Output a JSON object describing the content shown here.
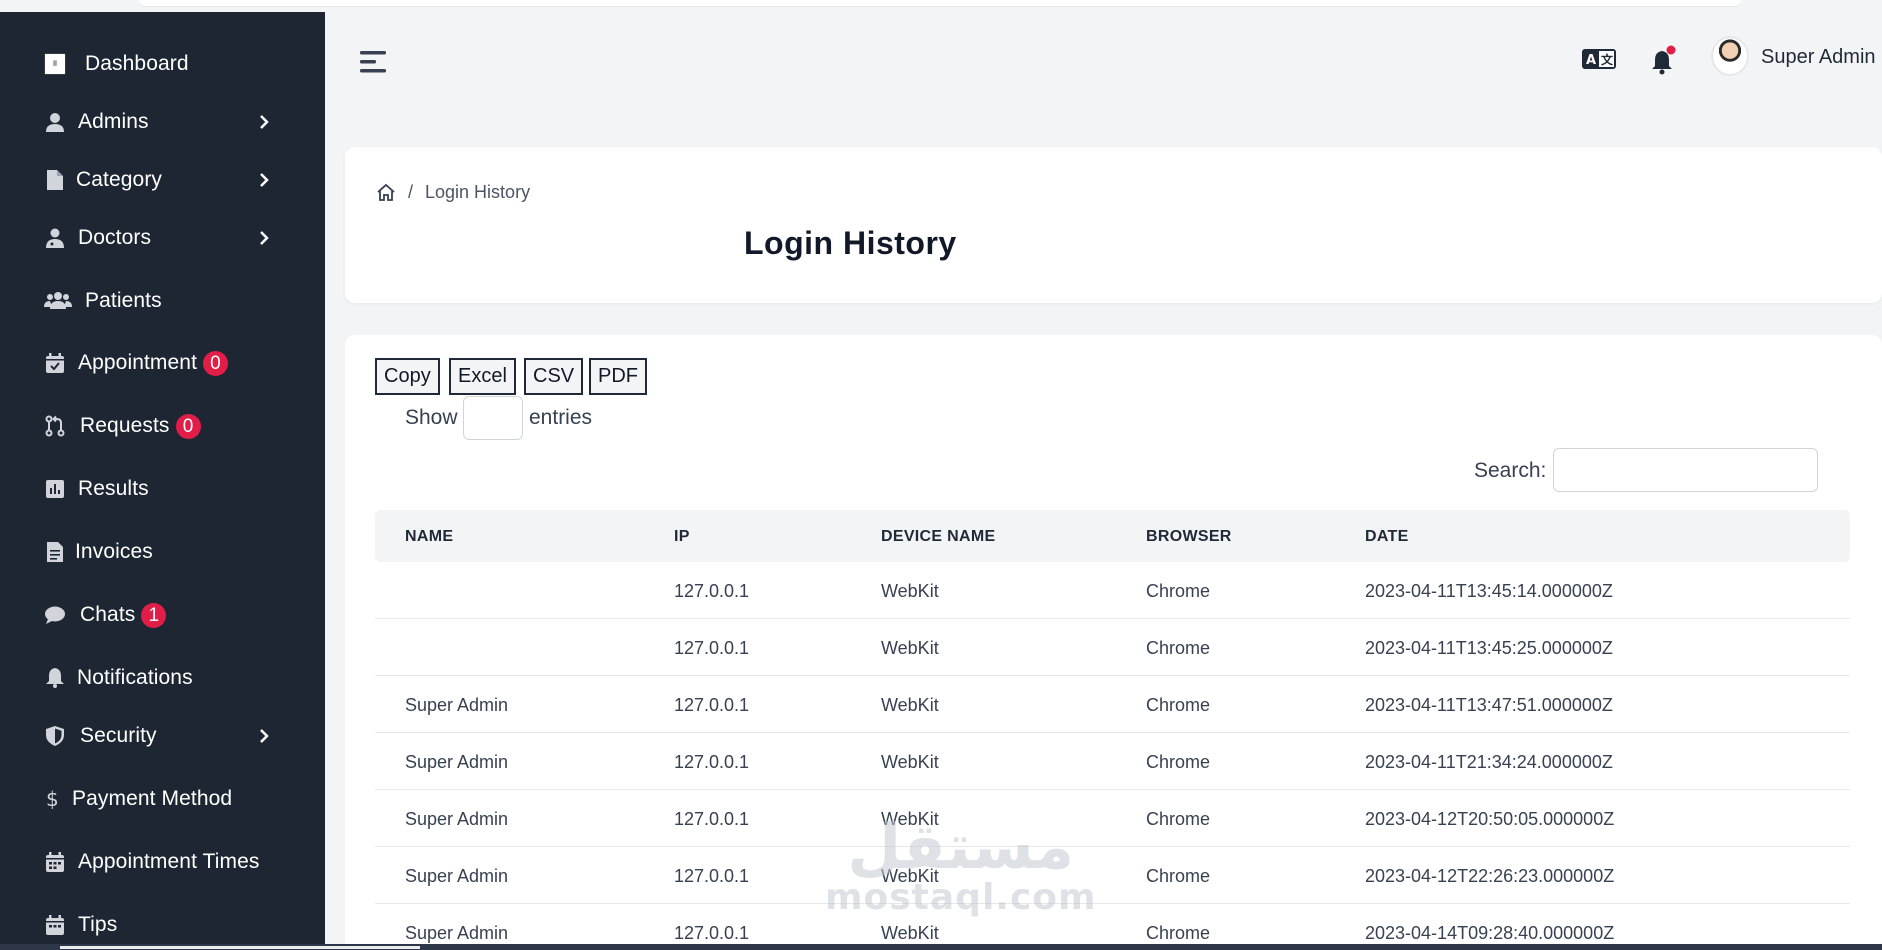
{
  "sidebar": {
    "items": [
      {
        "label": "Dashboard",
        "icon": "dashboard-icon",
        "badge": null,
        "has_submenu": false
      },
      {
        "label": "Admins",
        "icon": "user-icon",
        "badge": null,
        "has_submenu": true
      },
      {
        "label": "Category",
        "icon": "file-icon",
        "badge": null,
        "has_submenu": true
      },
      {
        "label": "Doctors",
        "icon": "doctor-icon",
        "badge": null,
        "has_submenu": true
      },
      {
        "label": "Patients",
        "icon": "users-icon",
        "badge": null,
        "has_submenu": false
      },
      {
        "label": "Appointment",
        "icon": "calendar-check-icon",
        "badge": "0",
        "has_submenu": false
      },
      {
        "label": "Requests",
        "icon": "pull-request-icon",
        "badge": "0",
        "has_submenu": false
      },
      {
        "label": "Results",
        "icon": "chart-icon",
        "badge": null,
        "has_submenu": false
      },
      {
        "label": "Invoices",
        "icon": "invoice-icon",
        "badge": null,
        "has_submenu": false
      },
      {
        "label": "Chats",
        "icon": "chat-icon",
        "badge": "1",
        "has_submenu": false
      },
      {
        "label": "Notifications",
        "icon": "bell-icon",
        "badge": null,
        "has_submenu": false
      },
      {
        "label": "Security",
        "icon": "shield-icon",
        "badge": null,
        "has_submenu": true
      },
      {
        "label": "Payment Method",
        "icon": "dollar-icon",
        "badge": null,
        "has_submenu": false
      },
      {
        "label": "Appointment Times",
        "icon": "calendar-icon",
        "badge": null,
        "has_submenu": false
      },
      {
        "label": "Tips",
        "icon": "calendar-icon",
        "badge": null,
        "has_submenu": false
      }
    ]
  },
  "header": {
    "user_name": "Super Admin"
  },
  "breadcrumb": {
    "current": "Login History"
  },
  "page": {
    "title": "Login History"
  },
  "export_buttons": [
    "Copy",
    "Excel",
    "CSV",
    "PDF"
  ],
  "length_control": {
    "show_label": "Show",
    "entries_label": "entries",
    "value": ""
  },
  "search": {
    "label": "Search:",
    "value": ""
  },
  "table": {
    "columns": [
      "NAME",
      "IP",
      "DEVICE NAME",
      "BROWSER",
      "DATE"
    ],
    "rows": [
      [
        "",
        "127.0.0.1",
        "WebKit",
        "Chrome",
        "2023-04-11T13:45:14.000000Z"
      ],
      [
        "",
        "127.0.0.1",
        "WebKit",
        "Chrome",
        "2023-04-11T13:45:25.000000Z"
      ],
      [
        "Super Admin",
        "127.0.0.1",
        "WebKit",
        "Chrome",
        "2023-04-11T13:47:51.000000Z"
      ],
      [
        "Super Admin",
        "127.0.0.1",
        "WebKit",
        "Chrome",
        "2023-04-11T21:34:24.000000Z"
      ],
      [
        "Super Admin",
        "127.0.0.1",
        "WebKit",
        "Chrome",
        "2023-04-12T20:50:05.000000Z"
      ],
      [
        "Super Admin",
        "127.0.0.1",
        "WebKit",
        "Chrome",
        "2023-04-12T22:26:23.000000Z"
      ],
      [
        "Super Admin",
        "127.0.0.1",
        "WebKit",
        "Chrome",
        "2023-04-14T09:28:40.000000Z"
      ]
    ]
  },
  "watermark": {
    "brand": "مستقل",
    "site": "mostaql.com"
  },
  "colors": {
    "sidebar_bg": "#1e2634",
    "badge": "#e11d48",
    "page_bg": "#f3f4f6",
    "notification_dot": "#e11d48"
  }
}
